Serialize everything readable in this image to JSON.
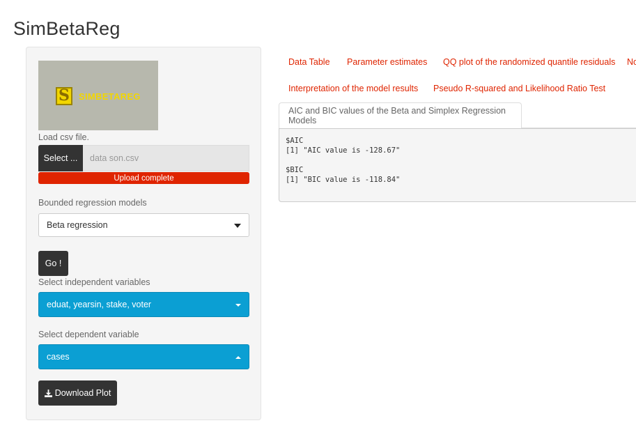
{
  "app": {
    "title": "SimBetaReg"
  },
  "sidebar": {
    "logo": {
      "letter": "S",
      "text": "SIMBETAREG"
    },
    "file": {
      "label": "Load csv file.",
      "button_label": "Select ...",
      "filename": "data son.csv",
      "progress_text": "Upload complete",
      "progress_pct": 100
    },
    "models": {
      "label": "Bounded regression models",
      "selected": "Beta regression"
    },
    "go_label": "Go !",
    "independent": {
      "label": "Select independent variables",
      "selected": "eduat, yearsin, stake, voter"
    },
    "dependent": {
      "label": "Select dependent variable",
      "selected": "cases"
    },
    "download_label": "Download Plot"
  },
  "tabs": [
    {
      "label": "Data Table"
    },
    {
      "label": "Parameter estimates"
    },
    {
      "label": "QQ plot of the randomized quantile residuals"
    },
    {
      "label": "No"
    },
    {
      "label": "Interpretation of the model results"
    },
    {
      "label": "Pseudo R-squared and Likelihood Ratio Test"
    },
    {
      "label": "AIC and BIC values of the Beta and Simplex Regression Models",
      "active": true
    }
  ],
  "output": {
    "lines": [
      "$AIC",
      "[1] \"AIC value is -128.67\"",
      "",
      "$BIC",
      "[1] \"BIC value is -118.84\""
    ]
  },
  "colors": {
    "accent_red": "#df2400",
    "picker_blue": "#0b9fd3",
    "dark_button": "#333333",
    "logo_bg": "#b7b8ad",
    "logo_yellow": "#f2d600"
  }
}
